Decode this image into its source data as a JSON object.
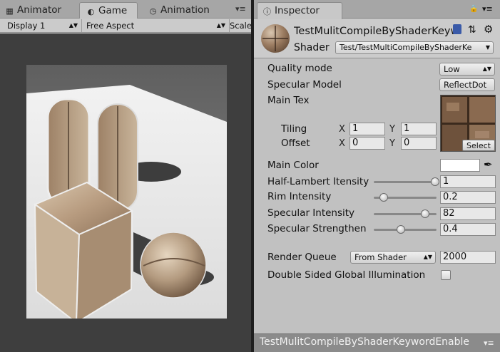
{
  "left_tabs": [
    {
      "label": "Animator",
      "icon": "animator-icon"
    },
    {
      "label": "Game",
      "icon": "game-pacman-icon"
    },
    {
      "label": "Animation",
      "icon": "clock-icon"
    }
  ],
  "game_toolbar": {
    "display": "Display 1",
    "aspect": "Free Aspect",
    "scale": "Scale"
  },
  "inspector": {
    "tab_label": "Inspector",
    "tab_icon": "info-icon",
    "material_name": "TestMulitCompileByShaderKeyw",
    "shader_label": "Shader",
    "shader_value": "Test/TestMultiCompileByShaderKe",
    "header_icons": [
      "book-icon",
      "preset-sliders-icon",
      "gear-icon"
    ],
    "properties": {
      "quality_mode": {
        "label": "Quality mode",
        "value": "Low"
      },
      "specular_model": {
        "label": "Specular Model",
        "value": "ReflectDot"
      },
      "main_tex": {
        "label": "Main Tex",
        "select_label": "Select"
      },
      "tiling": {
        "label": "Tiling",
        "x_label": "X",
        "x": "1",
        "y_label": "Y",
        "y": "1"
      },
      "offset": {
        "label": "Offset",
        "x_label": "X",
        "x": "0",
        "y_label": "Y",
        "y": "0"
      },
      "main_color": {
        "label": "Main Color",
        "color": "#ffffff"
      },
      "half_lambert": {
        "label": "Half-Lambert Itensity",
        "value": "1",
        "level": 1.0
      },
      "rim_intensity": {
        "label": "Rim Intensity",
        "value": "0.2",
        "level": 0.1
      },
      "specular_intensity": {
        "label": "Specular Intensity",
        "value": "82",
        "level": 0.82
      },
      "specular_strengthen": {
        "label": "Specular Strengthen",
        "value": "0.4",
        "level": 0.4
      },
      "render_queue": {
        "label": "Render Queue",
        "mode": "From Shader",
        "value": "2000"
      },
      "double_sided_gi": {
        "label": "Double Sided Global Illumination",
        "checked": false
      }
    },
    "footer_title": "TestMulitCompileByShaderKeywordEnable"
  },
  "colors": {
    "panel": "#c1c1c1",
    "game_bg": "#3e3e3e",
    "divider": "#1e1e1e",
    "footer": "#8b8b8b"
  }
}
